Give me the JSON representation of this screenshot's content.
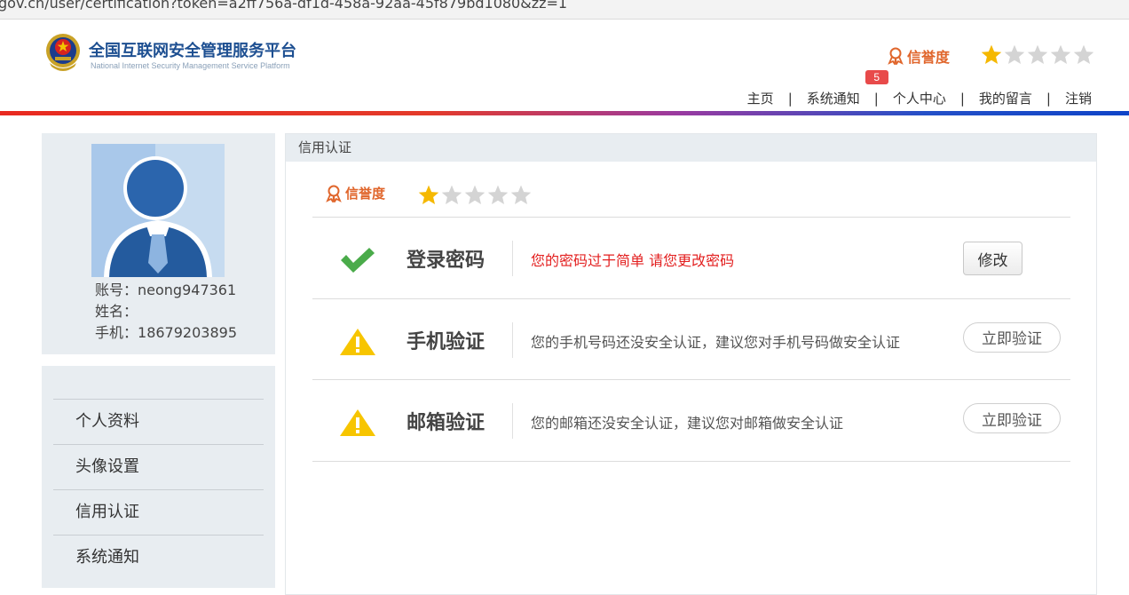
{
  "browser": {
    "url_fragment": "gov.cn/user/certification?token=a2ff756a-df1d-458a-92aa-45f879bd1080&zz=1"
  },
  "header": {
    "brand_title": "全国互联网安全管理服务平台",
    "brand_subtitle": "National Internet Security Management Service Platform",
    "credit_label": "信誉度",
    "credit_stars_filled": 1,
    "credit_stars_total": 5,
    "nav": [
      {
        "label": "主页"
      },
      {
        "label": "系统通知",
        "badge": "5"
      },
      {
        "label": "个人中心"
      },
      {
        "label": "我的留言"
      },
      {
        "label": "注销"
      }
    ],
    "nav_separator": "|"
  },
  "profile": {
    "account_label": "账号：",
    "account_value": "neong947361",
    "name_label": "姓名：",
    "name_value": "",
    "phone_label": "手机：",
    "phone_value": "18679203895"
  },
  "sidebar": {
    "items": [
      {
        "label": "个人资料"
      },
      {
        "label": "头像设置"
      },
      {
        "label": "信用认证"
      },
      {
        "label": "系统通知"
      }
    ]
  },
  "main": {
    "panel_title": "信用认证",
    "credit_label": "信誉度",
    "credit_stars_filled": 1,
    "credit_stars_total": 5,
    "rows": [
      {
        "status": "check-icon",
        "title": "登录密码",
        "desc": "您的密码过于简单 请您更改密码",
        "action": "修改"
      },
      {
        "status": "warning-icon",
        "title": "手机验证",
        "desc": "您的手机号码还没安全认证，建议您对手机号码做安全认证",
        "action": "立即验证"
      },
      {
        "status": "warning-icon",
        "title": "邮箱验证",
        "desc": "您的邮箱还没安全认证，建议您对邮箱做安全认证",
        "action": "立即验证"
      }
    ]
  },
  "colors": {
    "brand_blue": "#1d4f91",
    "credit_orange": "#e0662c",
    "star_filled": "#f5b800",
    "star_empty": "#d4d4d4",
    "warning_red": "#e32020",
    "check_green": "#4aab4a",
    "warning_yellow": "#f7c500",
    "badge_red": "#e84a4a",
    "panel_bg": "#e8edf1"
  }
}
